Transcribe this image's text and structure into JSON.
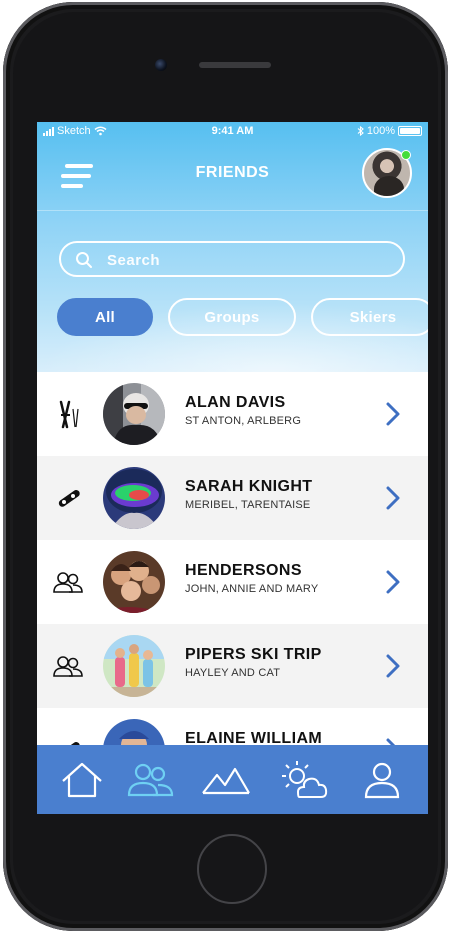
{
  "status_bar": {
    "carrier": "Sketch",
    "time": "9:41 AM",
    "battery_text": "100%"
  },
  "header": {
    "title": "FRIENDS",
    "online_status_color": "#44dd3c"
  },
  "search": {
    "placeholder": "Search",
    "value": ""
  },
  "filters": [
    {
      "label": "All",
      "active": true
    },
    {
      "label": "Groups",
      "active": false
    },
    {
      "label": "Skiers",
      "active": false
    }
  ],
  "friends": [
    {
      "name": "ALAN DAVIS",
      "subtitle": "ST ANTON, ARLBERG",
      "type_icon": "skis-icon"
    },
    {
      "name": "SARAH KNIGHT",
      "subtitle": "MERIBEL, TARENTAISE",
      "type_icon": "snowboard-icon"
    },
    {
      "name": "HENDERSONS",
      "subtitle": "JOHN, ANNIE AND MARY",
      "type_icon": "group-icon"
    },
    {
      "name": "PIPERS SKI TRIP",
      "subtitle": "HAYLEY AND CAT",
      "type_icon": "group-icon"
    },
    {
      "name": "ELAINE WILLIAM",
      "subtitle": "",
      "type_icon": "snowboard-icon"
    }
  ],
  "tab_bar": {
    "tabs": [
      "home-icon",
      "friends-icon",
      "mountains-icon",
      "weather-icon",
      "profile-icon"
    ],
    "active_tab": "friends-icon"
  },
  "colors": {
    "accent": "#4a7fcf",
    "active_tab_icon": "#6fd0f3",
    "chevron": "#3e6fc2",
    "sky_top": "#56bff0"
  }
}
